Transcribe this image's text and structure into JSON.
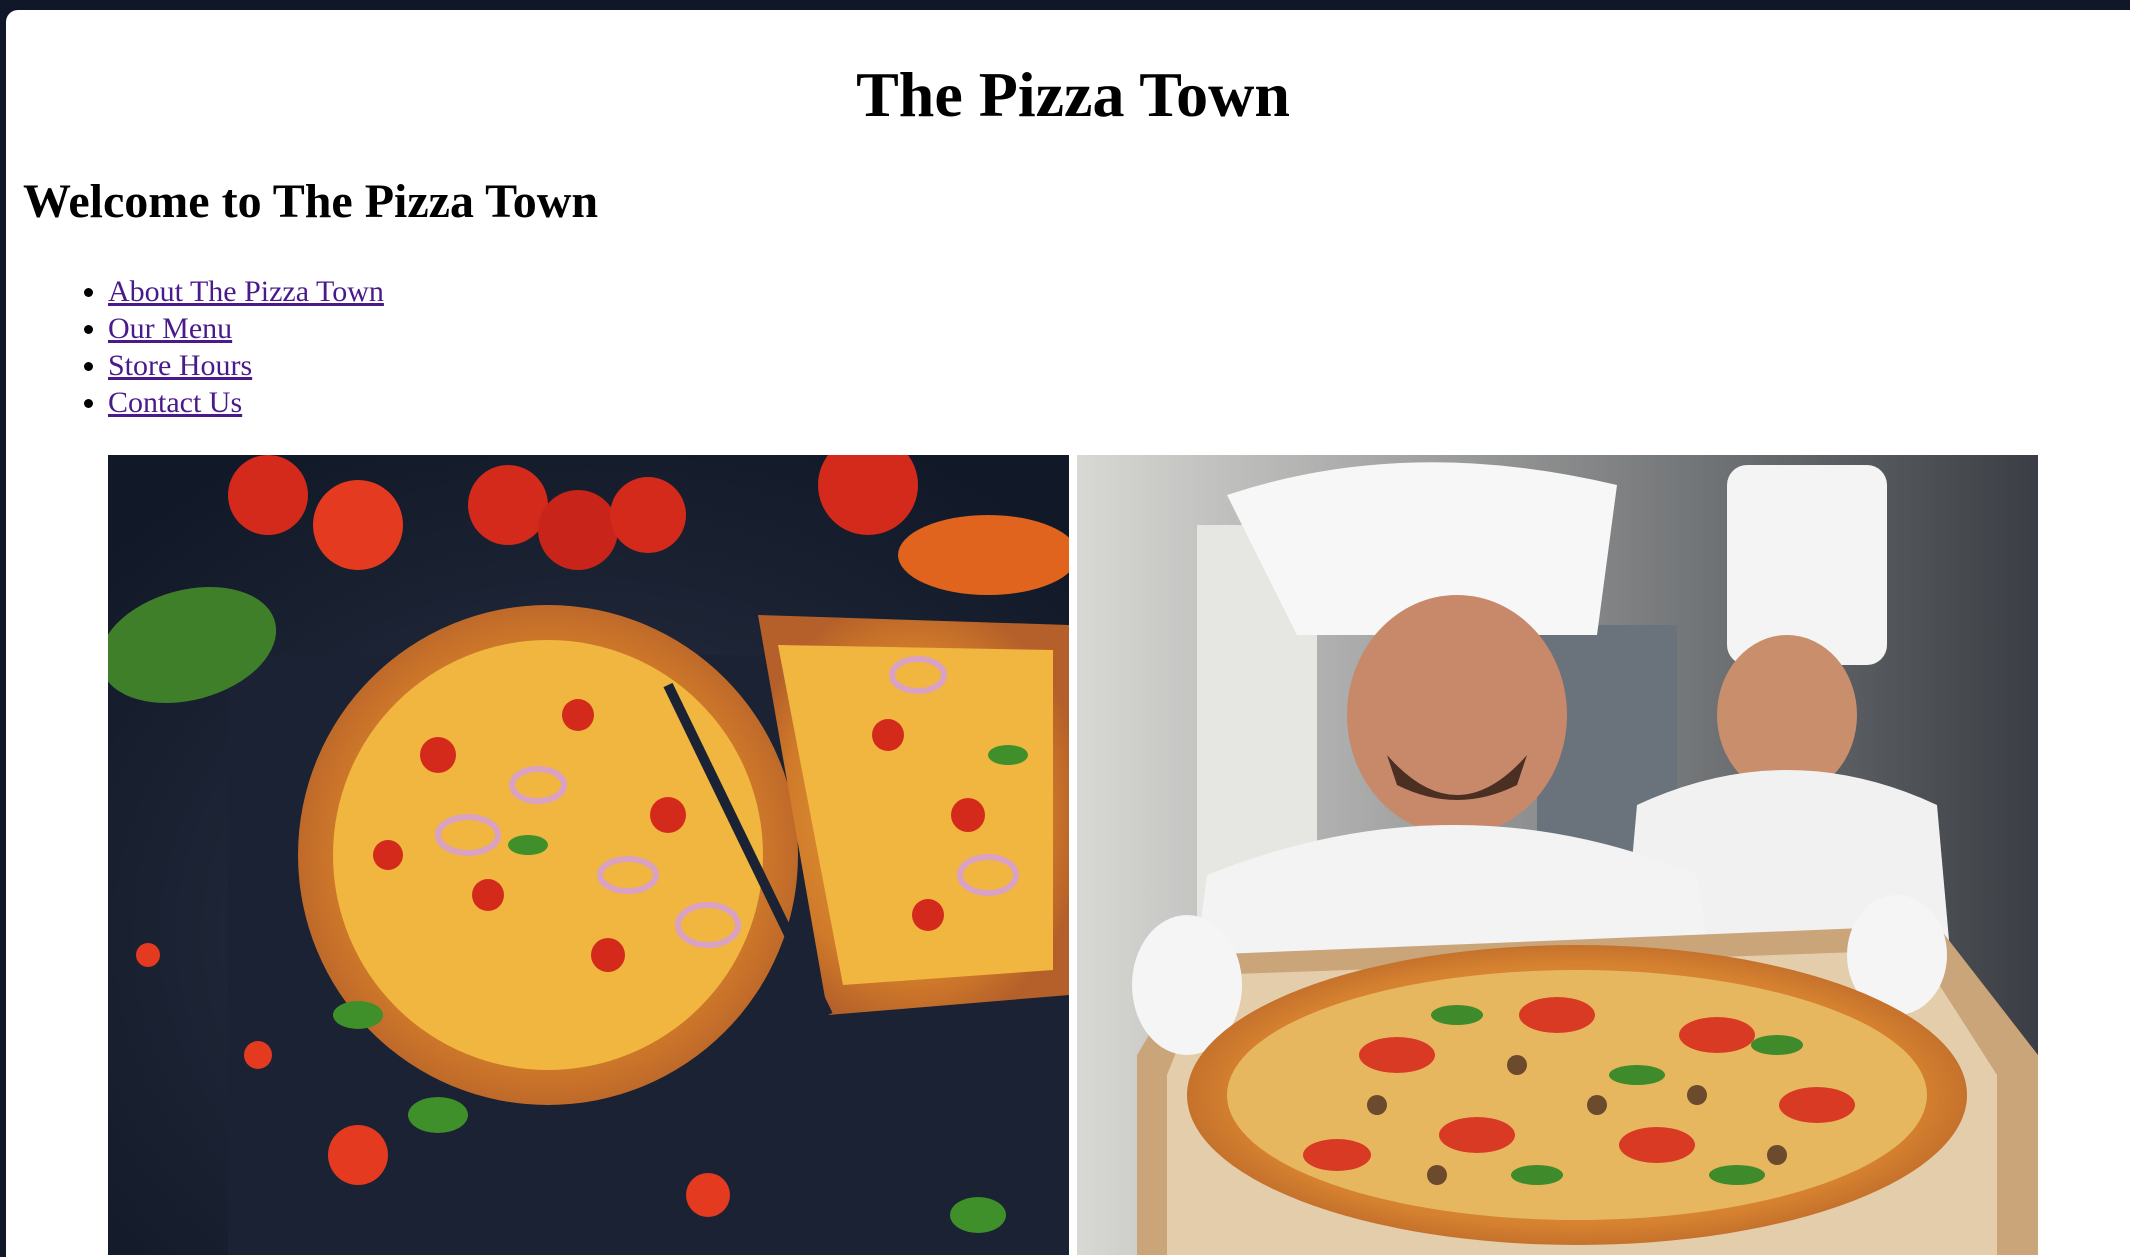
{
  "header": {
    "title": "The Pizza Town"
  },
  "main": {
    "heading": "Welcome to The Pizza Town",
    "nav": [
      {
        "label": "About The Pizza Town"
      },
      {
        "label": "Our Menu"
      },
      {
        "label": "Store Hours"
      },
      {
        "label": "Contact Us"
      }
    ]
  },
  "colors": {
    "link": "#4a1a8b",
    "chrome": "#0f1729"
  },
  "images": [
    {
      "icon": "pizza-photo-icon"
    },
    {
      "icon": "chefs-with-pizza-photo-icon"
    }
  ]
}
